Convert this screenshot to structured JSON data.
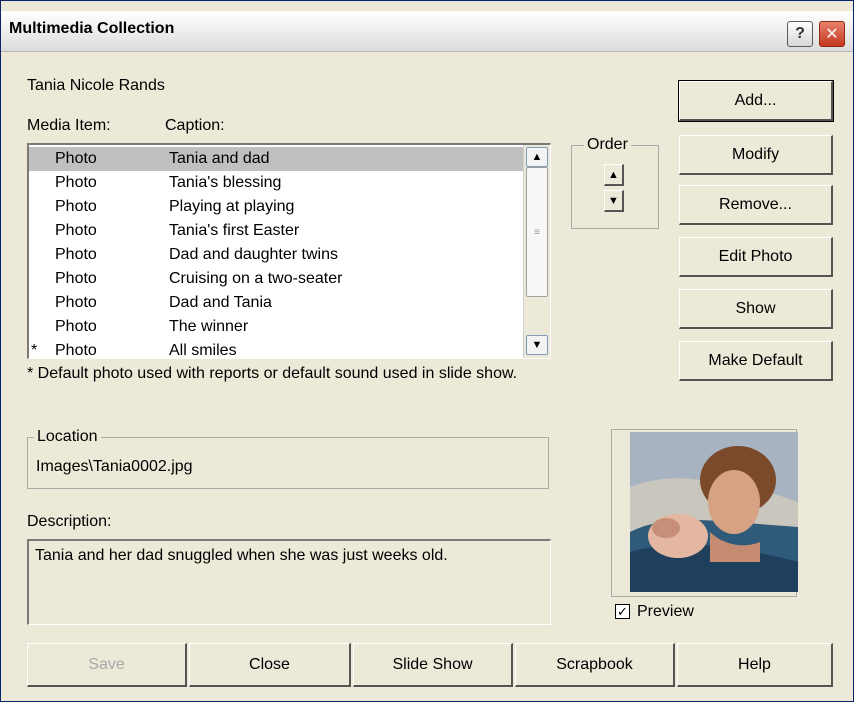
{
  "window": {
    "title": "Multimedia Collection",
    "help_glyph": "?",
    "close_glyph": "✕"
  },
  "person_name": "Tania Nicole Rands",
  "headers": {
    "media_item": "Media Item:",
    "caption": "Caption:"
  },
  "media_list": {
    "selected_index": 0,
    "rows": [
      {
        "mark": "",
        "type": "Photo",
        "caption": "Tania and dad"
      },
      {
        "mark": "",
        "type": "Photo",
        "caption": "Tania's blessing"
      },
      {
        "mark": "",
        "type": "Photo",
        "caption": "Playing at playing"
      },
      {
        "mark": "",
        "type": "Photo",
        "caption": "Tania's first Easter"
      },
      {
        "mark": "",
        "type": "Photo",
        "caption": "Dad and daughter twins"
      },
      {
        "mark": "",
        "type": "Photo",
        "caption": "Cruising on a two-seater"
      },
      {
        "mark": "",
        "type": "Photo",
        "caption": "Dad and Tania"
      },
      {
        "mark": "",
        "type": "Photo",
        "caption": "The winner"
      },
      {
        "mark": "*",
        "type": "Photo",
        "caption": "All smiles"
      }
    ]
  },
  "footnote": "* Default photo used with reports or default sound used in slide show.",
  "order": {
    "label": "Order",
    "up_glyph": "▲",
    "down_glyph": "▼"
  },
  "side_buttons": {
    "add": "Add...",
    "modify": "Modify",
    "remove": "Remove...",
    "edit_photo": "Edit Photo",
    "show": "Show",
    "make_default": "Make Default"
  },
  "location": {
    "label": "Location",
    "value": "Images\\Tania0002.jpg"
  },
  "description": {
    "label": "Description:",
    "value": "Tania and her dad snuggled when she was just weeks old."
  },
  "preview": {
    "label": "Preview",
    "checked": true,
    "check_glyph": "✓"
  },
  "bottom_buttons": {
    "save": "Save",
    "close": "Close",
    "slide_show": "Slide Show",
    "scrapbook": "Scrapbook",
    "help": "Help"
  },
  "icons": {
    "scroll_up": "chevron-up-icon",
    "scroll_down": "chevron-down-icon",
    "scroll_grip": "grip-icon"
  }
}
